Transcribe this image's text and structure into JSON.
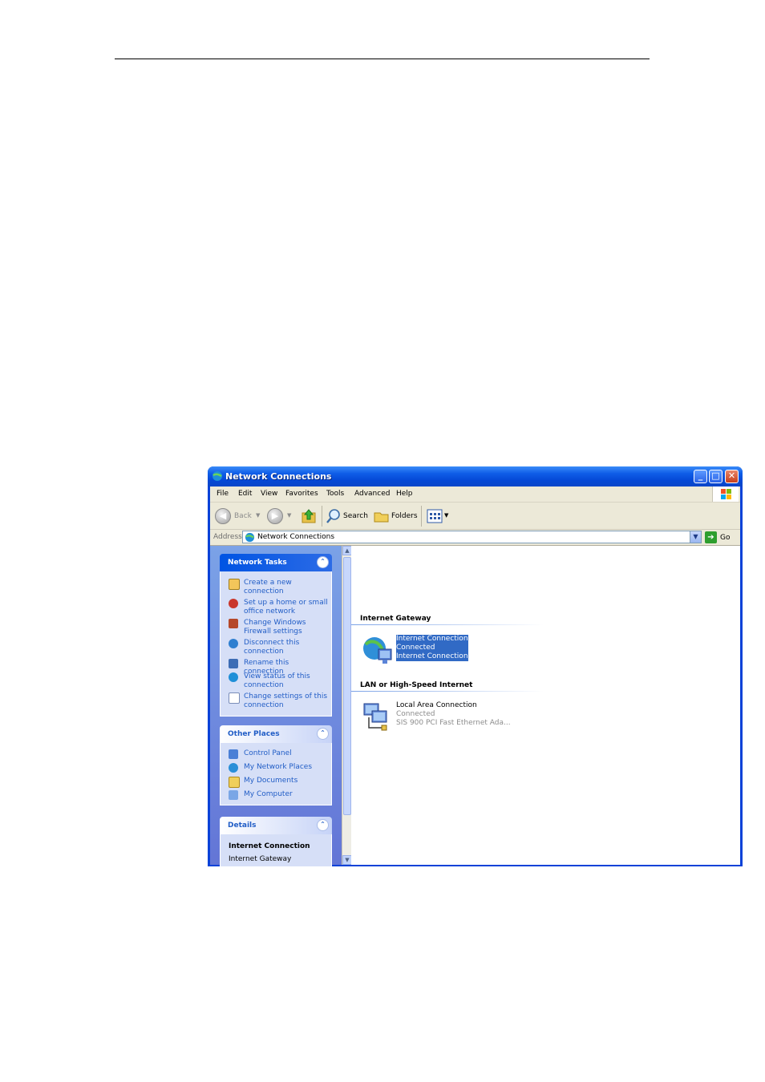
{
  "window": {
    "title": "Network Connections"
  },
  "menubar": [
    "File",
    "Edit",
    "View",
    "Favorites",
    "Tools",
    "Advanced",
    "Help"
  ],
  "toolbar": {
    "back": "Back",
    "search": "Search",
    "folders": "Folders"
  },
  "address": {
    "label": "Address",
    "value": "Network Connections",
    "go": "Go"
  },
  "network_tasks": {
    "title": "Network Tasks",
    "items": [
      "Create a new\nconnection",
      "Set up a home or small\noffice network",
      "Change Windows\nFirewall settings",
      "Disconnect this\nconnection",
      "Rename this connection",
      "View status of this\nconnection",
      "Change settings of this\nconnection"
    ]
  },
  "other_places": {
    "title": "Other Places",
    "items": [
      "Control Panel",
      "My Network Places",
      "My Documents",
      "My Computer"
    ]
  },
  "details": {
    "title": "Details",
    "name": "Internet Connection",
    "type": "Internet Gateway"
  },
  "groups": [
    {
      "title": "Internet Gateway",
      "connection": {
        "name": "Internet Connection",
        "status": "Connected",
        "device": "Internet Connection"
      }
    },
    {
      "title": "LAN or High-Speed Internet",
      "connection": {
        "name": "Local Area Connection",
        "status": "Connected",
        "device": "SIS 900 PCI Fast Ethernet Ada..."
      }
    }
  ],
  "colors": {
    "titlebar": "#0a54e3",
    "selection": "#316ac5",
    "link": "#215dc6",
    "taskpane": "#7ba2e7"
  },
  "icons": [
    "network-connections-icon",
    "back-arrow-icon",
    "forward-arrow-icon",
    "up-folder-icon",
    "search-icon",
    "folders-icon",
    "views-icon",
    "go-arrow-icon",
    "windows-flag-icon"
  ]
}
